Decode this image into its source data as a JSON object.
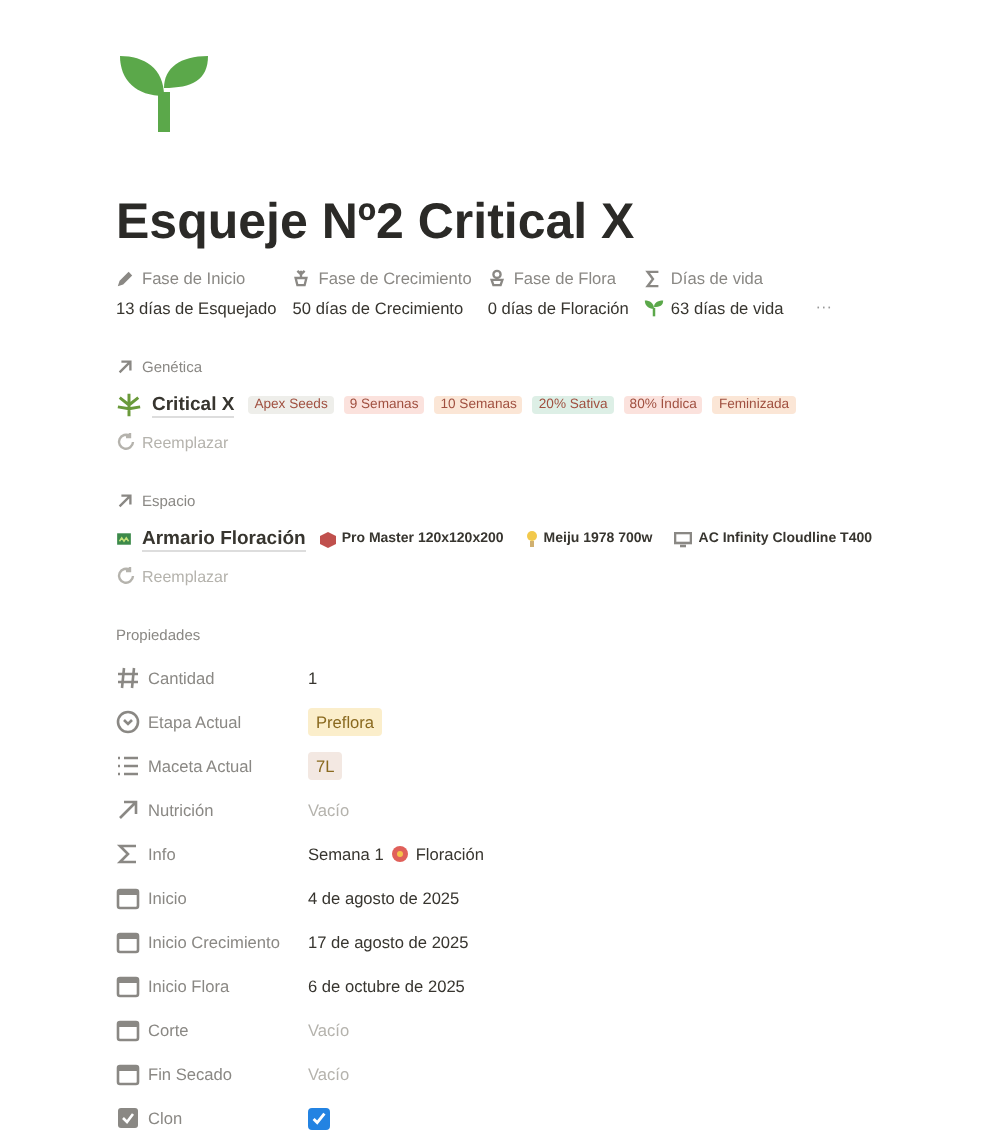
{
  "title": "Esqueje Nº2 Critical X",
  "phases": [
    {
      "label": "Fase de Inicio",
      "value": "13 días de Esquejado"
    },
    {
      "label": "Fase de Crecimiento",
      "value": "50 días de Crecimiento"
    },
    {
      "label": "Fase de Flora",
      "value": "0 días de Floración"
    },
    {
      "label": "Días de vida",
      "value": "63 días de vida"
    }
  ],
  "more": "···",
  "genetics": {
    "heading": "Genética",
    "name": "Critical X",
    "tags": [
      {
        "label": "Apex Seeds",
        "color": "#eeeeea"
      },
      {
        "label": "9 Semanas",
        "color": "#fbe2dd"
      },
      {
        "label": "10 Semanas",
        "color": "#fbe6d6"
      },
      {
        "label": "20% Sativa",
        "color": "#ddefe6"
      },
      {
        "label": "80% Índica",
        "color": "#fbe2dd"
      },
      {
        "label": "Feminizada",
        "color": "#fbe6d6"
      }
    ],
    "replace": "Reemplazar"
  },
  "space": {
    "heading": "Espacio",
    "name": "Armario Floración",
    "items": [
      "Pro Master 120x120x200",
      "Meiju 1978 700w",
      "AC Infinity Cloudline T400"
    ],
    "replace": "Reemplazar"
  },
  "properties_heading": "Propiedades",
  "properties": [
    {
      "kind": "number",
      "label": "Cantidad",
      "value": "1"
    },
    {
      "kind": "select",
      "label": "Etapa Actual",
      "value": "Preflora",
      "color": "#fbeecb"
    },
    {
      "kind": "multi_select",
      "label": "Maceta Actual",
      "value": "7L",
      "color": "#f3e8e2"
    },
    {
      "kind": "relation",
      "label": "Nutrición",
      "placeholder": "Vacío"
    },
    {
      "kind": "formula",
      "label": "Info",
      "parts": [
        "Semana 1",
        "Floración"
      ]
    },
    {
      "kind": "date",
      "label": "Inicio",
      "value": "4 de agosto de 2025"
    },
    {
      "kind": "date",
      "label": "Inicio Crecimiento",
      "value": "17 de agosto de 2025"
    },
    {
      "kind": "date",
      "label": "Inicio Flora",
      "value": "6 de octubre de 2025"
    },
    {
      "kind": "date",
      "label": "Corte",
      "placeholder": "Vacío"
    },
    {
      "kind": "date",
      "label": "Fin Secado",
      "placeholder": "Vacío"
    },
    {
      "kind": "checkbox",
      "label": "Clon",
      "checked": true
    }
  ]
}
